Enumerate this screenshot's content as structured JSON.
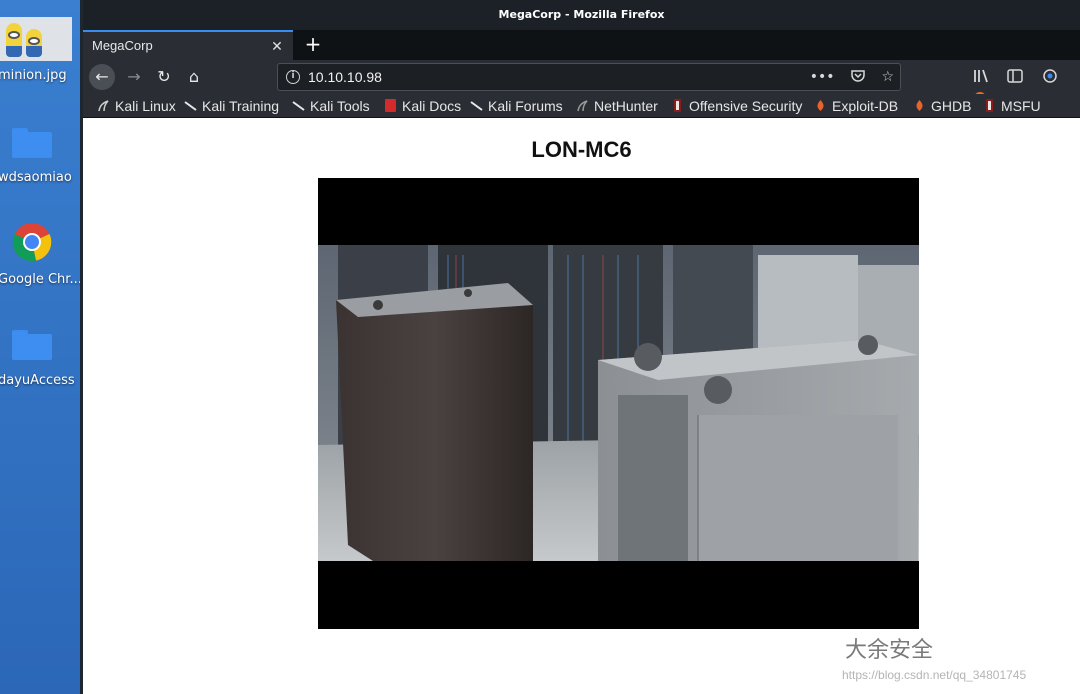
{
  "desktop": {
    "items": [
      {
        "label": "minion.jpg",
        "icon": "minion-image-icon"
      },
      {
        "label": "wdsaomiao",
        "icon": "folder-icon"
      },
      {
        "label": "Google Chr...",
        "icon": "chrome-icon"
      },
      {
        "label": "dayuAccess",
        "icon": "folder-icon"
      }
    ]
  },
  "window": {
    "title": "MegaCorp - Mozilla Firefox"
  },
  "tabs": [
    {
      "label": "MegaCorp",
      "active": true
    }
  ],
  "navbar": {
    "url": "10.10.10.98"
  },
  "bookmarks": [
    {
      "label": "Kali Linux",
      "icon": "kali-dragon-icon"
    },
    {
      "label": "Kali Training",
      "icon": "kali-dragon-icon"
    },
    {
      "label": "Kali Tools",
      "icon": "kali-dragon-icon"
    },
    {
      "label": "Kali Docs",
      "icon": "kali-docs-icon"
    },
    {
      "label": "Kali Forums",
      "icon": "kali-dragon-icon"
    },
    {
      "label": "NetHunter",
      "icon": "nethunter-icon"
    },
    {
      "label": "Offensive Security",
      "icon": "offsec-icon"
    },
    {
      "label": "Exploit-DB",
      "icon": "exploitdb-icon"
    },
    {
      "label": "GHDB",
      "icon": "exploitdb-icon"
    },
    {
      "label": "MSFU",
      "icon": "offsec-icon"
    }
  ],
  "page": {
    "title": "LON-MC6"
  },
  "watermark": {
    "brand": "大余安全",
    "url": "https://blog.csdn.net/qq_34801745"
  },
  "colors": {
    "chrome_dark": "#2a2e34",
    "tab_accent": "#3b8cf0",
    "desktop_blue": "#2f6fc0"
  }
}
